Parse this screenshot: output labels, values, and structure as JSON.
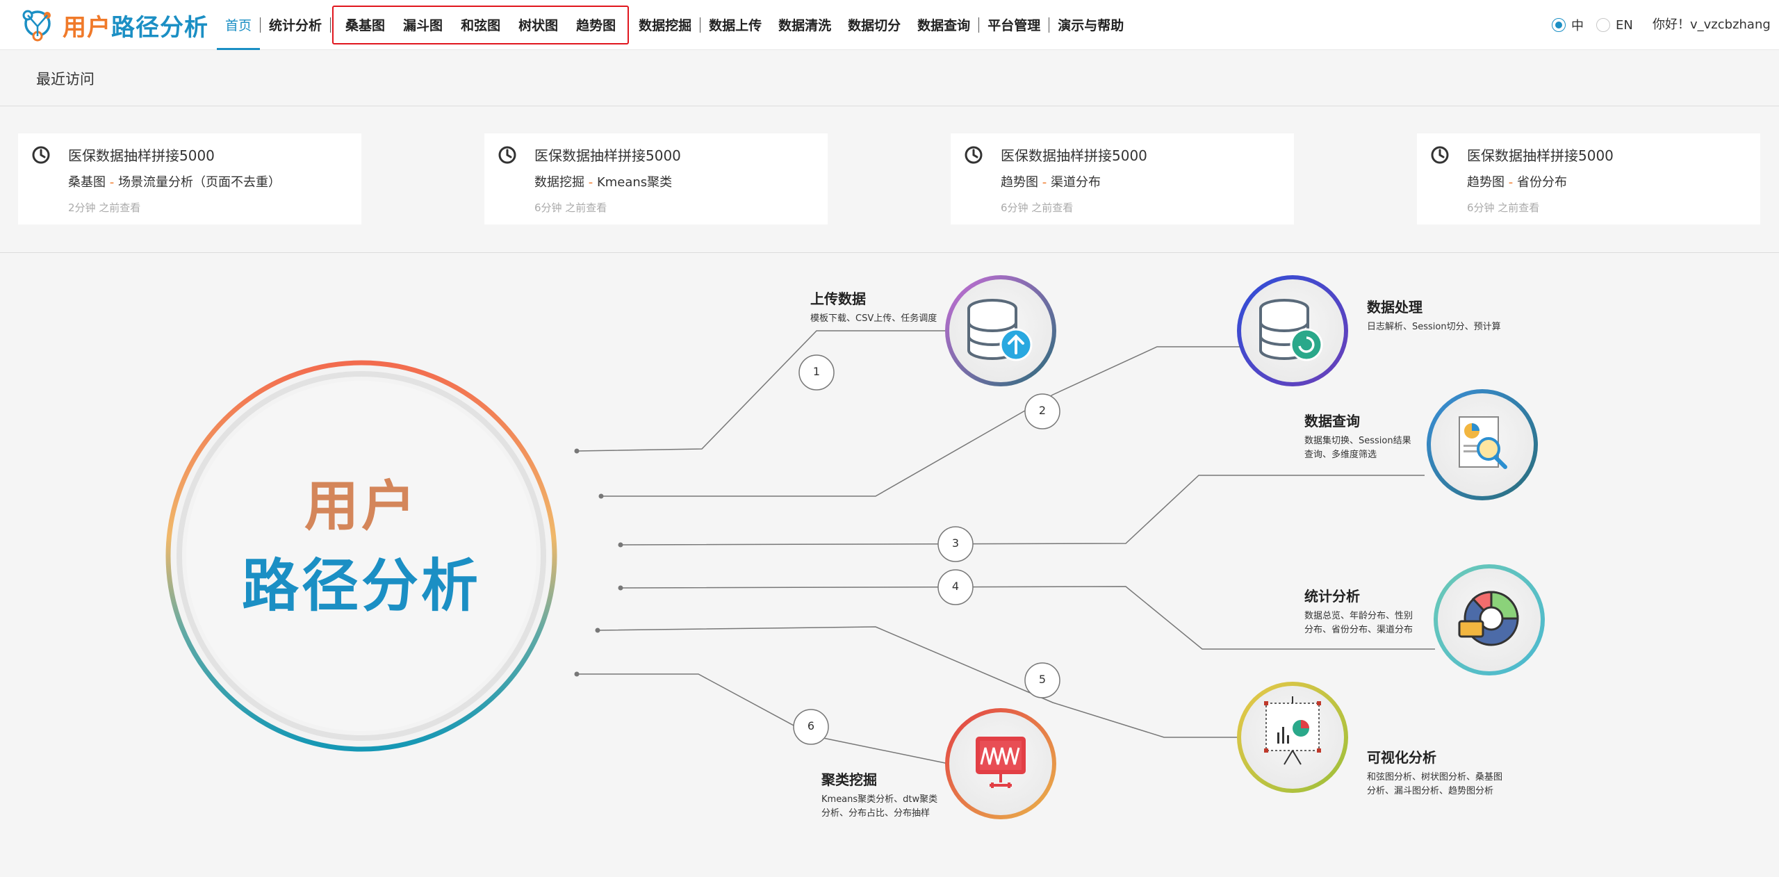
{
  "app": {
    "title_part1": "用户",
    "title_part2": "路径分析"
  },
  "nav": {
    "home": "首页",
    "stats": "统计分析",
    "sankey": "桑基图",
    "funnel": "漏斗图",
    "chord": "和弦图",
    "tree": "树状图",
    "trend": "趋势图",
    "mining": "数据挖掘",
    "upload": "数据上传",
    "clean": "数据清洗",
    "split": "数据切分",
    "query": "数据查询",
    "platform": "平台管理",
    "demo": "演示与帮助"
  },
  "lang": {
    "zh": "中",
    "en": "EN",
    "selected": "中"
  },
  "greeting": "你好！v_vzcbzhang",
  "recent": {
    "title": "最近访问",
    "cards": [
      {
        "title": "医保数据抽样拼接5000",
        "sub_main": "桑基图",
        "sub_dash": " - ",
        "sub_detail": "场景流量分析（页面不去重）",
        "time": "2分钟 之前查看"
      },
      {
        "title": "医保数据抽样拼接5000",
        "sub_main": "数据挖掘",
        "sub_dash": " - ",
        "sub_detail": "Kmeans聚类",
        "time": "6分钟 之前查看"
      },
      {
        "title": "医保数据抽样拼接5000",
        "sub_main": "趋势图",
        "sub_dash": " - ",
        "sub_detail": "渠道分布",
        "time": "6分钟 之前查看"
      },
      {
        "title": "医保数据抽样拼接5000",
        "sub_main": "趋势图",
        "sub_dash": " - ",
        "sub_detail": "省份分布",
        "time": "6分钟 之前查看"
      }
    ]
  },
  "diagram": {
    "center_line1": "用户",
    "center_line2": "路径分析",
    "numbers": [
      "1",
      "2",
      "3",
      "4",
      "5",
      "6"
    ],
    "steps": [
      {
        "title": "上传数据",
        "desc": [
          "模板下载、CSV上传、任务调度"
        ]
      },
      {
        "title": "数据处理",
        "desc": [
          "日志解析、Session切分、预计算"
        ]
      },
      {
        "title": "数据查询",
        "desc": [
          "数据集切换、Session结果",
          "查询、多维度筛选"
        ]
      },
      {
        "title": "统计分析",
        "desc": [
          "数据总览、年龄分布、性别",
          "分布、省份分布、渠道分布"
        ]
      },
      {
        "title": "可视化分析",
        "desc": [
          "和弦图分析、树状图分析、桑基图",
          "分析、漏斗图分析、趋势图分析"
        ]
      },
      {
        "title": "聚类挖掘",
        "desc": [
          "Kmeans聚类分析、dtw聚类",
          "分析、分布占比、分布抽样"
        ]
      }
    ]
  },
  "colors": {
    "brand_orange": "#f07a2a",
    "brand_blue": "#1b8fc4",
    "highlight_red": "#e0161e",
    "center_text_orange": "#d4865a",
    "center_text_blue": "#1b8fc4"
  },
  "icons": {
    "logo": "path-network-logo",
    "clock": "clock-icon",
    "upload": "database-upload-icon",
    "process": "database-refresh-icon",
    "query": "report-search-icon",
    "stats": "pie-chart-icon",
    "visual": "presentation-chart-icon",
    "cluster": "monitor-chart-icon"
  }
}
